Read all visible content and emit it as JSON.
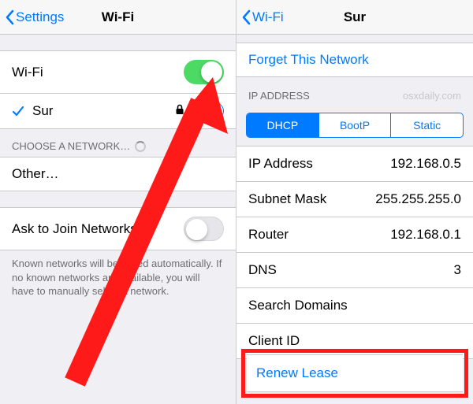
{
  "left": {
    "back": "Settings",
    "title": "Wi-Fi",
    "wifi_label": "Wi-Fi",
    "wifi_on": true,
    "connected_network": "Sur",
    "choose_header": "CHOOSE A NETWORK…",
    "other_label": "Other…",
    "ask_label": "Ask to Join Networks",
    "ask_on": false,
    "ask_footer": "Known networks will be joined automatically. If no known networks are available, you will have to manually select a network."
  },
  "right": {
    "back": "Wi-Fi",
    "title": "Sur",
    "forget": "Forget This Network",
    "ip_header": "IP ADDRESS",
    "watermark": "osxdaily.com",
    "seg": {
      "dhcp": "DHCP",
      "bootp": "BootP",
      "static": "Static",
      "active": "dhcp"
    },
    "rows": {
      "ip_label": "IP Address",
      "ip_value": "192.168.0.5",
      "mask_label": "Subnet Mask",
      "mask_value": "255.255.255.0",
      "router_label": "Router",
      "router_value": "192.168.0.1",
      "dns_label": "DNS",
      "dns_value": "3",
      "search_label": "Search Domains",
      "search_value": "",
      "client_label": "Client ID",
      "client_value": ""
    },
    "renew": "Renew Lease"
  }
}
